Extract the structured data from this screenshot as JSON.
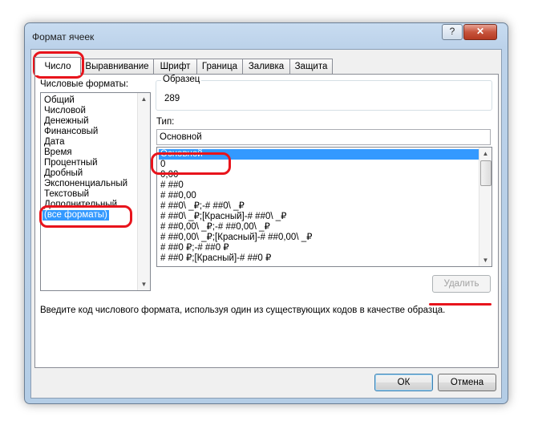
{
  "window": {
    "title": "Формат ячеек",
    "help_label": "?",
    "close_label": "✕"
  },
  "tabs": [
    "Число",
    "Выравнивание",
    "Шрифт",
    "Граница",
    "Заливка",
    "Защита"
  ],
  "categories": {
    "label": "Числовые форматы:",
    "items": [
      "Общий",
      "Числовой",
      "Денежный",
      "Финансовый",
      "Дата",
      "Время",
      "Процентный",
      "Дробный",
      "Экспоненциальный",
      "Текстовый",
      "Дополнительный",
      "(все форматы)"
    ],
    "selected": "(все форматы)"
  },
  "sample": {
    "label": "Образец",
    "value": "289"
  },
  "type": {
    "label": "Тип:",
    "value": "Основной",
    "items": [
      "Основной",
      "0",
      "0,00",
      "# ##0",
      "# ##0,00",
      "# ##0\\ _₽;-# ##0\\ _₽",
      "# ##0\\ _₽;[Красный]-# ##0\\ _₽",
      "# ##0,00\\ _₽;-# ##0,00\\ _₽",
      "# ##0,00\\ _₽;[Красный]-# ##0,00\\ _₽",
      "# ##0 ₽;-# ##0 ₽",
      "# ##0 ₽;[Красный]-# ##0 ₽"
    ],
    "selected": "Основной"
  },
  "buttons": {
    "delete": "Удалить",
    "ok": "ОК",
    "cancel": "Отмена"
  },
  "description": "Введите код числового формата, используя один из существующих кодов в качестве образца.",
  "colors": {
    "highlight": "#3399ff",
    "annotation_red": "#e8141c"
  }
}
